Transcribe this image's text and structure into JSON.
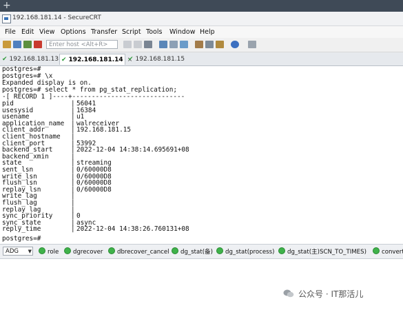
{
  "window": {
    "title": "192.168.181.14 - SecureCRT"
  },
  "menu": [
    "File",
    "Edit",
    "View",
    "Options",
    "Transfer",
    "Script",
    "Tools",
    "Window",
    "Help"
  ],
  "toolbar": {
    "host_placeholder": "Enter host <Alt+R>"
  },
  "tabs": [
    {
      "label": "192.168.181.13",
      "active": false
    },
    {
      "label": "192.168.181.14",
      "active": true,
      "close": "×"
    },
    {
      "label": "192.168.181.15",
      "active": false
    }
  ],
  "terminal": {
    "intro_lines": [
      "postgres=#",
      "postgres=# \\x",
      "Expanded display is on.",
      "postgres=# select * from pg_stat_replication;",
      "-[ RECORD 1 ]----+-----------------------------"
    ],
    "record": [
      {
        "key": "pid",
        "value": "56041"
      },
      {
        "key": "usesysid",
        "value": "16384"
      },
      {
        "key": "usename",
        "value": "u1"
      },
      {
        "key": "application_name",
        "value": "walreceiver"
      },
      {
        "key": "client_addr",
        "value": "192.168.181.15"
      },
      {
        "key": "client_hostname",
        "value": ""
      },
      {
        "key": "client_port",
        "value": "53992"
      },
      {
        "key": "backend_start",
        "value": "2022-12-04 14:38:14.695691+08"
      },
      {
        "key": "backend_xmin",
        "value": ""
      },
      {
        "key": "state",
        "value": "streaming"
      },
      {
        "key": "sent_lsn",
        "value": "0/60000D8"
      },
      {
        "key": "write_lsn",
        "value": "0/60000D8"
      },
      {
        "key": "flush_lsn",
        "value": "0/60000D8"
      },
      {
        "key": "replay_lsn",
        "value": "0/60000D8"
      },
      {
        "key": "write_lag",
        "value": ""
      },
      {
        "key": "flush_lag",
        "value": ""
      },
      {
        "key": "replay_lag",
        "value": ""
      },
      {
        "key": "sync_priority",
        "value": "0"
      },
      {
        "key": "sync_state",
        "value": "async"
      },
      {
        "key": "reply_time",
        "value": "2022-12-04 14:38:26.760131+08"
      }
    ],
    "prompt_after": "postgres=#"
  },
  "button_bar": {
    "session": "ADG",
    "buttons": [
      "role",
      "dgrecover",
      "dbrecover_cancel",
      "dg_stat(备)",
      "dg_stat(process)",
      "dg_stat(主)SCN_TO_TIMES)",
      "convert"
    ]
  },
  "watermark": "公众号 · IT那活儿"
}
